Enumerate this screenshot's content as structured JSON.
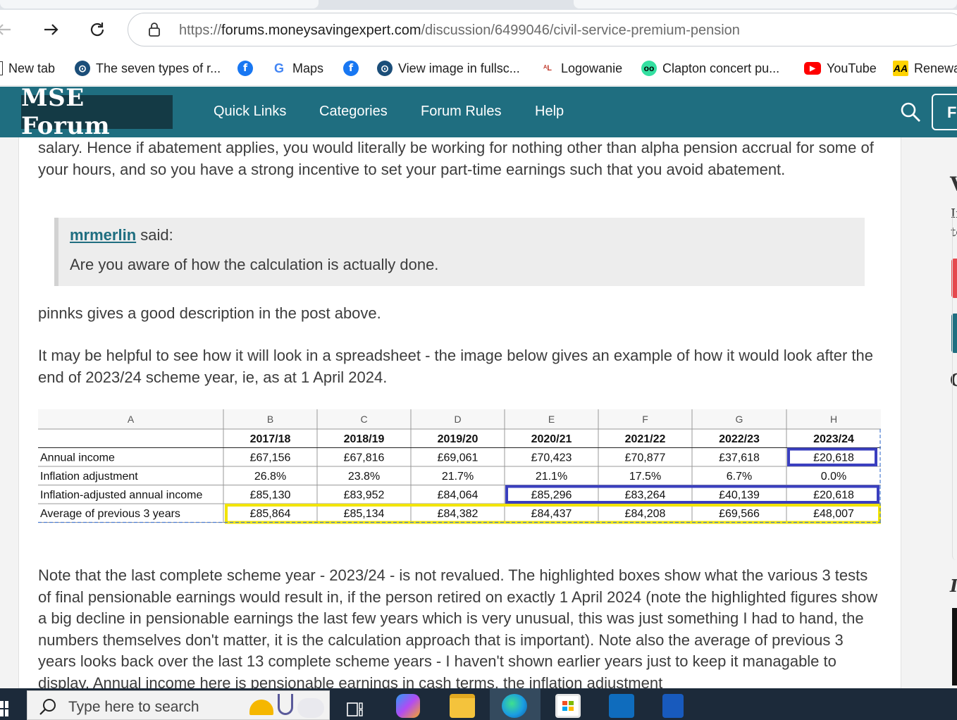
{
  "browser": {
    "url_scheme": "https://",
    "url_host": "forums.moneysavingexpert.com",
    "url_path": "/discussion/6499046/civil-service-premium-pension",
    "bookmarks": [
      {
        "label": "New tab",
        "icon": "page-icon"
      },
      {
        "label": "The seven types of r...",
        "icon": "globe-icon"
      },
      {
        "label": "",
        "icon": "facebook-icon"
      },
      {
        "label": "Maps",
        "icon": "google-icon"
      },
      {
        "label": "",
        "icon": "facebook-icon"
      },
      {
        "label": "View image in fullsc...",
        "icon": "globe-icon"
      },
      {
        "label": "Logowanie",
        "icon": "logowanie-icon"
      },
      {
        "label": "Clapton concert pu...",
        "icon": "tripadvisor-icon"
      },
      {
        "label": "YouTube",
        "icon": "youtube-icon"
      },
      {
        "label": "Renewa",
        "icon": "aa-icon"
      }
    ]
  },
  "site": {
    "logo": "MSE Forum",
    "nav": [
      "Quick Links",
      "Categories",
      "Forum Rules",
      "Help"
    ],
    "header_button": "F"
  },
  "post": {
    "para1": "salary. Hence if abatement applies, you would literally be working for nothing other than alpha pension accrual for some of your hours, and so you have a strong incentive to set your part-time earnings such that you avoid abatement.",
    "quote_author": "mrmerlin",
    "quote_said": " said:",
    "quote_text": "Are you aware of how the calculation is actually done.",
    "para2": "pinnks gives a good description in the post above.",
    "para3": "It may be helpful to see how it will look in a spreadsheet - the image below gives an example of how it would look after the end of 2023/24 scheme year, ie, as at 1 April 2024.",
    "para4": "Note that the last complete scheme year - 2023/24 - is not revalued. The highlighted boxes show what the various 3 tests of final pensionable earnings would result in, if the person retired on exactly 1 April 2024 (note the highlighted figures show a big decline in pensionable earnings the last few years which is very unusual, this was just something I had to hand, the numbers themselves don't matter, it is the calculation approach that is important). Note also the average of previous 3 years looks back over the last 13 complete scheme years - I haven't shown earlier years just to keep it managable to display. Annual income here is pensionable earnings in cash terms, the inflation adjustment"
  },
  "spreadsheet": {
    "col_letters": [
      "A",
      "B",
      "C",
      "D",
      "E",
      "F",
      "G",
      "H"
    ],
    "years": [
      "",
      "2017/18",
      "2018/19",
      "2019/20",
      "2020/21",
      "2021/22",
      "2022/23",
      "2023/24"
    ],
    "rows": [
      {
        "label": "Annual income",
        "values": [
          "£67,156",
          "£67,816",
          "£69,061",
          "£70,423",
          "£70,877",
          "£37,618",
          "£20,618"
        ]
      },
      {
        "label": "Inflation adjustment",
        "values": [
          "26.8%",
          "23.8%",
          "21.7%",
          "21.1%",
          "17.5%",
          "6.7%",
          "0.0%"
        ]
      },
      {
        "label": "Inflation-adjusted annual income",
        "values": [
          "£85,130",
          "£83,952",
          "£84,064",
          "£85,296",
          "£83,264",
          "£40,139",
          "£20,618"
        ]
      },
      {
        "label": "Average of previous 3 years",
        "values": [
          "£85,864",
          "£85,134",
          "£84,382",
          "£84,437",
          "£84,208",
          "£69,566",
          "£48,007"
        ]
      }
    ],
    "highlight_blue": "#3a3fbf",
    "highlight_yellow": "#f2e400"
  },
  "sidebar": {
    "frag1": "V",
    "frag2": "If",
    "frag3": "to",
    "frag4": "C",
    "frag5": "I"
  },
  "taskbar": {
    "search_placeholder": "Type here to search"
  },
  "colors": {
    "header": "#1f6e80",
    "logo_bg": "#143a45",
    "taskbar": "#1c2a3a"
  }
}
